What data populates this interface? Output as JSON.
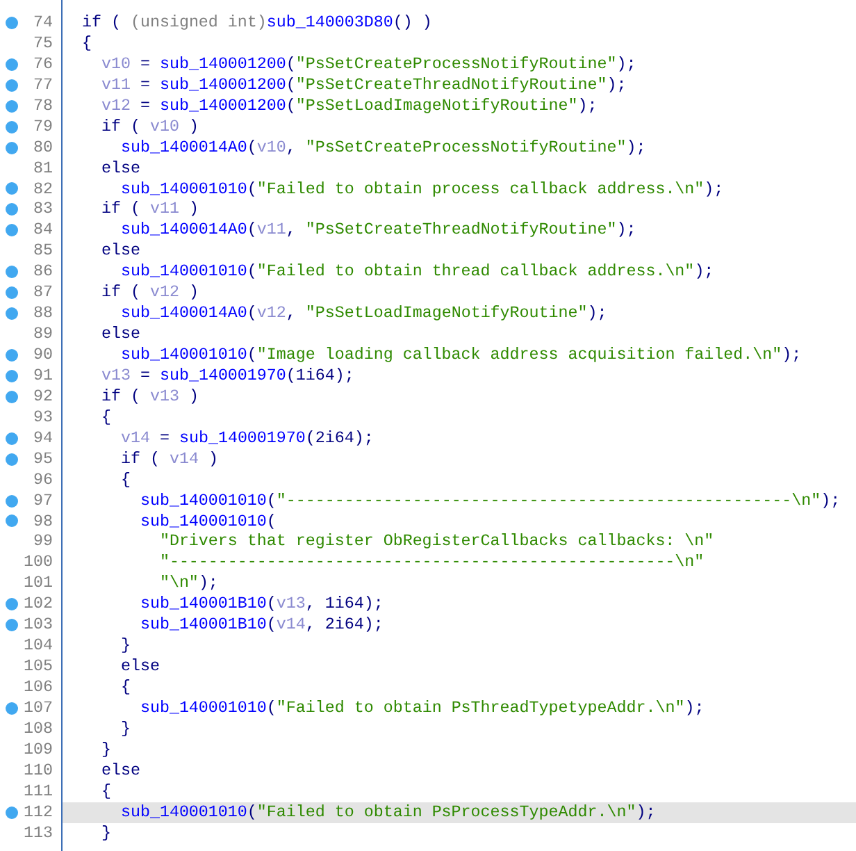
{
  "lines": [
    {
      "number": "74",
      "breakpoint": true,
      "highlighted": false,
      "tokens": [
        {
          "kind": "keyword",
          "text": "  if ( "
        },
        {
          "kind": "cast",
          "text": "(unsigned int)"
        },
        {
          "kind": "function",
          "text": "sub_140003D80"
        },
        {
          "kind": "punct",
          "text": "() )"
        }
      ]
    },
    {
      "number": "75",
      "breakpoint": false,
      "highlighted": false,
      "tokens": [
        {
          "kind": "punct",
          "text": "  {"
        }
      ]
    },
    {
      "number": "76",
      "breakpoint": true,
      "highlighted": false,
      "tokens": [
        {
          "kind": "variable",
          "text": "    v10"
        },
        {
          "kind": "punct",
          "text": " = "
        },
        {
          "kind": "function",
          "text": "sub_140001200"
        },
        {
          "kind": "punct",
          "text": "("
        },
        {
          "kind": "string",
          "text": "\"PsSetCreateProcessNotifyRoutine\""
        },
        {
          "kind": "punct",
          "text": ");"
        }
      ]
    },
    {
      "number": "77",
      "breakpoint": true,
      "highlighted": false,
      "tokens": [
        {
          "kind": "variable",
          "text": "    v11"
        },
        {
          "kind": "punct",
          "text": " = "
        },
        {
          "kind": "function",
          "text": "sub_140001200"
        },
        {
          "kind": "punct",
          "text": "("
        },
        {
          "kind": "string",
          "text": "\"PsSetCreateThreadNotifyRoutine\""
        },
        {
          "kind": "punct",
          "text": ");"
        }
      ]
    },
    {
      "number": "78",
      "breakpoint": true,
      "highlighted": false,
      "tokens": [
        {
          "kind": "variable",
          "text": "    v12"
        },
        {
          "kind": "punct",
          "text": " = "
        },
        {
          "kind": "function",
          "text": "sub_140001200"
        },
        {
          "kind": "punct",
          "text": "("
        },
        {
          "kind": "string",
          "text": "\"PsSetLoadImageNotifyRoutine\""
        },
        {
          "kind": "punct",
          "text": ");"
        }
      ]
    },
    {
      "number": "79",
      "breakpoint": true,
      "highlighted": false,
      "tokens": [
        {
          "kind": "keyword",
          "text": "    if ( "
        },
        {
          "kind": "variable",
          "text": "v10"
        },
        {
          "kind": "punct",
          "text": " )"
        }
      ]
    },
    {
      "number": "80",
      "breakpoint": true,
      "highlighted": false,
      "tokens": [
        {
          "kind": "function",
          "text": "      sub_1400014A0"
        },
        {
          "kind": "punct",
          "text": "("
        },
        {
          "kind": "variable",
          "text": "v10"
        },
        {
          "kind": "punct",
          "text": ", "
        },
        {
          "kind": "string",
          "text": "\"PsSetCreateProcessNotifyRoutine\""
        },
        {
          "kind": "punct",
          "text": ");"
        }
      ]
    },
    {
      "number": "81",
      "breakpoint": false,
      "highlighted": false,
      "tokens": [
        {
          "kind": "keyword",
          "text": "    else"
        }
      ]
    },
    {
      "number": "82",
      "breakpoint": true,
      "highlighted": false,
      "tokens": [
        {
          "kind": "function",
          "text": "      sub_140001010"
        },
        {
          "kind": "punct",
          "text": "("
        },
        {
          "kind": "string",
          "text": "\"Failed to obtain process callback address.\\n\""
        },
        {
          "kind": "punct",
          "text": ");"
        }
      ]
    },
    {
      "number": "83",
      "breakpoint": true,
      "highlighted": false,
      "tokens": [
        {
          "kind": "keyword",
          "text": "    if ( "
        },
        {
          "kind": "variable",
          "text": "v11"
        },
        {
          "kind": "punct",
          "text": " )"
        }
      ]
    },
    {
      "number": "84",
      "breakpoint": true,
      "highlighted": false,
      "tokens": [
        {
          "kind": "function",
          "text": "      sub_1400014A0"
        },
        {
          "kind": "punct",
          "text": "("
        },
        {
          "kind": "variable",
          "text": "v11"
        },
        {
          "kind": "punct",
          "text": ", "
        },
        {
          "kind": "string",
          "text": "\"PsSetCreateThreadNotifyRoutine\""
        },
        {
          "kind": "punct",
          "text": ");"
        }
      ]
    },
    {
      "number": "85",
      "breakpoint": false,
      "highlighted": false,
      "tokens": [
        {
          "kind": "keyword",
          "text": "    else"
        }
      ]
    },
    {
      "number": "86",
      "breakpoint": true,
      "highlighted": false,
      "tokens": [
        {
          "kind": "function",
          "text": "      sub_140001010"
        },
        {
          "kind": "punct",
          "text": "("
        },
        {
          "kind": "string",
          "text": "\"Failed to obtain thread callback address.\\n\""
        },
        {
          "kind": "punct",
          "text": ");"
        }
      ]
    },
    {
      "number": "87",
      "breakpoint": true,
      "highlighted": false,
      "tokens": [
        {
          "kind": "keyword",
          "text": "    if ( "
        },
        {
          "kind": "variable",
          "text": "v12"
        },
        {
          "kind": "punct",
          "text": " )"
        }
      ]
    },
    {
      "number": "88",
      "breakpoint": true,
      "highlighted": false,
      "tokens": [
        {
          "kind": "function",
          "text": "      sub_1400014A0"
        },
        {
          "kind": "punct",
          "text": "("
        },
        {
          "kind": "variable",
          "text": "v12"
        },
        {
          "kind": "punct",
          "text": ", "
        },
        {
          "kind": "string",
          "text": "\"PsSetLoadImageNotifyRoutine\""
        },
        {
          "kind": "punct",
          "text": ");"
        }
      ]
    },
    {
      "number": "89",
      "breakpoint": false,
      "highlighted": false,
      "tokens": [
        {
          "kind": "keyword",
          "text": "    else"
        }
      ]
    },
    {
      "number": "90",
      "breakpoint": true,
      "highlighted": false,
      "tokens": [
        {
          "kind": "function",
          "text": "      sub_140001010"
        },
        {
          "kind": "punct",
          "text": "("
        },
        {
          "kind": "string",
          "text": "\"Image loading callback address acquisition failed.\\n\""
        },
        {
          "kind": "punct",
          "text": ");"
        }
      ]
    },
    {
      "number": "91",
      "breakpoint": true,
      "highlighted": false,
      "tokens": [
        {
          "kind": "variable",
          "text": "    v13"
        },
        {
          "kind": "punct",
          "text": " = "
        },
        {
          "kind": "function",
          "text": "sub_140001970"
        },
        {
          "kind": "punct",
          "text": "(1i64);"
        }
      ]
    },
    {
      "number": "92",
      "breakpoint": true,
      "highlighted": false,
      "tokens": [
        {
          "kind": "keyword",
          "text": "    if ( "
        },
        {
          "kind": "variable",
          "text": "v13"
        },
        {
          "kind": "punct",
          "text": " )"
        }
      ]
    },
    {
      "number": "93",
      "breakpoint": false,
      "highlighted": false,
      "tokens": [
        {
          "kind": "punct",
          "text": "    {"
        }
      ]
    },
    {
      "number": "94",
      "breakpoint": true,
      "highlighted": false,
      "tokens": [
        {
          "kind": "variable",
          "text": "      v14"
        },
        {
          "kind": "punct",
          "text": " = "
        },
        {
          "kind": "function",
          "text": "sub_140001970"
        },
        {
          "kind": "punct",
          "text": "(2i64);"
        }
      ]
    },
    {
      "number": "95",
      "breakpoint": true,
      "highlighted": false,
      "tokens": [
        {
          "kind": "keyword",
          "text": "      if ( "
        },
        {
          "kind": "variable",
          "text": "v14"
        },
        {
          "kind": "punct",
          "text": " )"
        }
      ]
    },
    {
      "number": "96",
      "breakpoint": false,
      "highlighted": false,
      "tokens": [
        {
          "kind": "punct",
          "text": "      {"
        }
      ]
    },
    {
      "number": "97",
      "breakpoint": true,
      "highlighted": false,
      "tokens": [
        {
          "kind": "function",
          "text": "        sub_140001010"
        },
        {
          "kind": "punct",
          "text": "("
        },
        {
          "kind": "string",
          "text": "\"----------------------------------------------------\\n\""
        },
        {
          "kind": "punct",
          "text": ");"
        }
      ]
    },
    {
      "number": "98",
      "breakpoint": true,
      "highlighted": false,
      "tokens": [
        {
          "kind": "function",
          "text": "        sub_140001010"
        },
        {
          "kind": "punct",
          "text": "("
        }
      ]
    },
    {
      "number": "99",
      "breakpoint": false,
      "highlighted": false,
      "tokens": [
        {
          "kind": "string",
          "text": "          \"Drivers that register ObRegisterCallbacks callbacks: \\n\""
        }
      ]
    },
    {
      "number": "100",
      "breakpoint": false,
      "highlighted": false,
      "tokens": [
        {
          "kind": "string",
          "text": "          \"----------------------------------------------------\\n\""
        }
      ]
    },
    {
      "number": "101",
      "breakpoint": false,
      "highlighted": false,
      "tokens": [
        {
          "kind": "string",
          "text": "          \"\\n\""
        },
        {
          "kind": "punct",
          "text": ");"
        }
      ]
    },
    {
      "number": "102",
      "breakpoint": true,
      "highlighted": false,
      "tokens": [
        {
          "kind": "function",
          "text": "        sub_140001B10"
        },
        {
          "kind": "punct",
          "text": "("
        },
        {
          "kind": "variable",
          "text": "v13"
        },
        {
          "kind": "punct",
          "text": ", 1i64);"
        }
      ]
    },
    {
      "number": "103",
      "breakpoint": true,
      "highlighted": false,
      "tokens": [
        {
          "kind": "function",
          "text": "        sub_140001B10"
        },
        {
          "kind": "punct",
          "text": "("
        },
        {
          "kind": "variable",
          "text": "v14"
        },
        {
          "kind": "punct",
          "text": ", 2i64);"
        }
      ]
    },
    {
      "number": "104",
      "breakpoint": false,
      "highlighted": false,
      "tokens": [
        {
          "kind": "punct",
          "text": "      }"
        }
      ]
    },
    {
      "number": "105",
      "breakpoint": false,
      "highlighted": false,
      "tokens": [
        {
          "kind": "keyword",
          "text": "      else"
        }
      ]
    },
    {
      "number": "106",
      "breakpoint": false,
      "highlighted": false,
      "tokens": [
        {
          "kind": "punct",
          "text": "      {"
        }
      ]
    },
    {
      "number": "107",
      "breakpoint": true,
      "highlighted": false,
      "tokens": [
        {
          "kind": "function",
          "text": "        sub_140001010"
        },
        {
          "kind": "punct",
          "text": "("
        },
        {
          "kind": "string",
          "text": "\"Failed to obtain PsThreadTypetypeAddr.\\n\""
        },
        {
          "kind": "punct",
          "text": ");"
        }
      ]
    },
    {
      "number": "108",
      "breakpoint": false,
      "highlighted": false,
      "tokens": [
        {
          "kind": "punct",
          "text": "      }"
        }
      ]
    },
    {
      "number": "109",
      "breakpoint": false,
      "highlighted": false,
      "tokens": [
        {
          "kind": "punct",
          "text": "    }"
        }
      ]
    },
    {
      "number": "110",
      "breakpoint": false,
      "highlighted": false,
      "tokens": [
        {
          "kind": "keyword",
          "text": "    else"
        }
      ]
    },
    {
      "number": "111",
      "breakpoint": false,
      "highlighted": false,
      "tokens": [
        {
          "kind": "punct",
          "text": "    {"
        }
      ]
    },
    {
      "number": "112",
      "breakpoint": true,
      "highlighted": true,
      "tokens": [
        {
          "kind": "function",
          "text": "      sub_140001010"
        },
        {
          "kind": "punct",
          "text": "("
        },
        {
          "kind": "string",
          "text": "\"Failed to obtain PsProcessTypeAddr.\\n\""
        },
        {
          "kind": "punct",
          "text": ");"
        }
      ]
    },
    {
      "number": "113",
      "breakpoint": false,
      "highlighted": false,
      "tokens": [
        {
          "kind": "punct",
          "text": "    }"
        }
      ]
    }
  ]
}
